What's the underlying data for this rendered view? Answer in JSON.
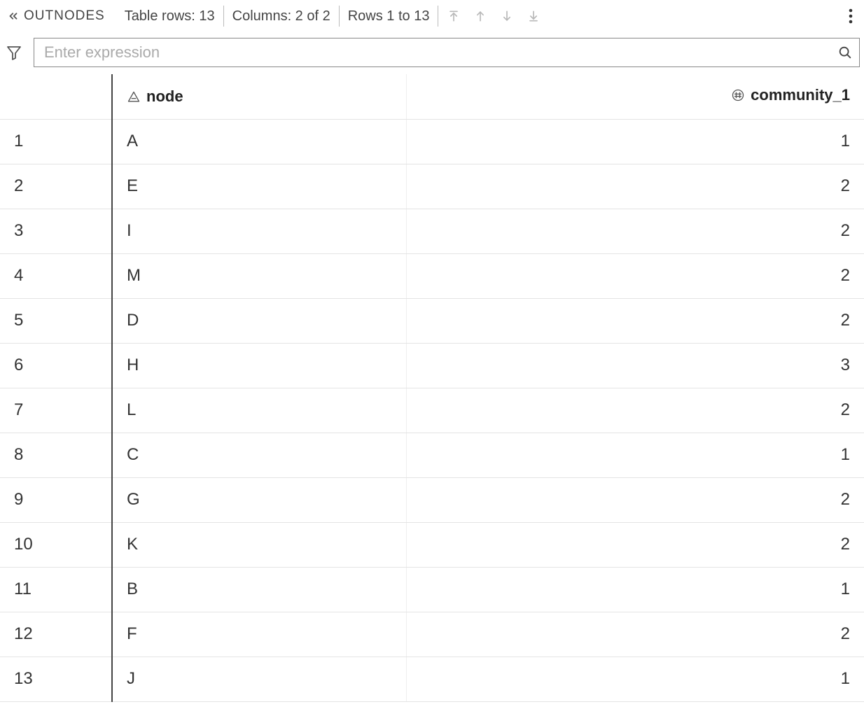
{
  "toolbar": {
    "title": "OUTNODES",
    "table_rows_label": "Table rows: 13",
    "columns_label": "Columns: 2 of 2",
    "rows_range_label": "Rows 1 to 13"
  },
  "filter": {
    "placeholder": "Enter expression",
    "value": ""
  },
  "columns": [
    {
      "key": "node",
      "label": "node",
      "icon": "text-type-icon",
      "align": "left"
    },
    {
      "key": "community_1",
      "label": "community_1",
      "icon": "number-type-icon",
      "align": "right"
    }
  ],
  "rows": [
    {
      "idx": 1,
      "node": "A",
      "community_1": 1
    },
    {
      "idx": 2,
      "node": "E",
      "community_1": 2
    },
    {
      "idx": 3,
      "node": "I",
      "community_1": 2
    },
    {
      "idx": 4,
      "node": "M",
      "community_1": 2
    },
    {
      "idx": 5,
      "node": "D",
      "community_1": 2
    },
    {
      "idx": 6,
      "node": "H",
      "community_1": 3
    },
    {
      "idx": 7,
      "node": "L",
      "community_1": 2
    },
    {
      "idx": 8,
      "node": "C",
      "community_1": 1
    },
    {
      "idx": 9,
      "node": "G",
      "community_1": 2
    },
    {
      "idx": 10,
      "node": "K",
      "community_1": 2
    },
    {
      "idx": 11,
      "node": "B",
      "community_1": 1
    },
    {
      "idx": 12,
      "node": "F",
      "community_1": 2
    },
    {
      "idx": 13,
      "node": "J",
      "community_1": 1
    }
  ]
}
